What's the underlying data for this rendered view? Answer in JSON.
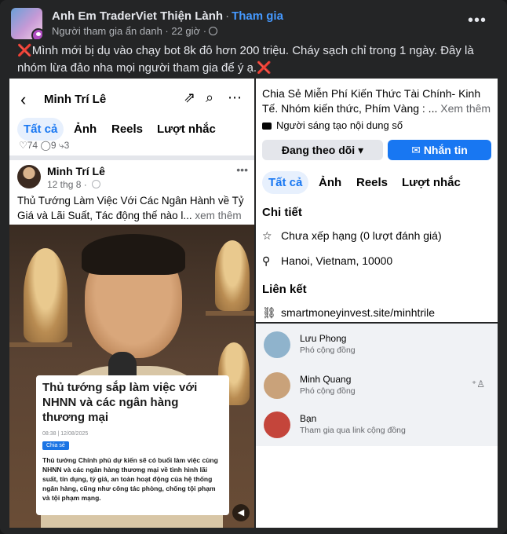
{
  "header": {
    "group_name": "Anh Em TraderViet Thiện Lành",
    "join_label": "Tham gia",
    "meta": "Người tham gia ẩn danh · 22 giờ ·"
  },
  "caption": {
    "mark_start": "❌",
    "text": "Mình mới bị dụ vào chạy bot 8k đô hơn 200 triệu. Cháy sạch chỉ trong 1 ngày. Đây là nhóm lừa đảo nha mọi người tham gia để ý ạ.",
    "mark_end": "❌"
  },
  "left_panel": {
    "profile_name": "Minh Trí Lê",
    "tabs": [
      "Tất cả",
      "Ảnh",
      "Reels",
      "Lượt nhắc"
    ],
    "reaction_row": "♡74    ◯9    ⤷3",
    "post": {
      "author": "Minh Trí Lê",
      "date": "12 thg 8 · ",
      "text": "Thủ Tướng Làm Việc Với Các Ngân Hành về Tỷ Giá và Lãi Suất, Tác động thế nào l...",
      "see_more": " xem thêm"
    },
    "news_card": {
      "headline": "Thủ tướng sắp làm việc với NHNN và các ngân hàng thương mại",
      "timestamp": "08:38 | 12/08/2025",
      "tag": "Chia sẻ",
      "body": "Thủ tướng Chính phủ dự kiến sẽ có buổi làm việc cùng NHNN và các ngân hàng thương mại về tình hình lãi suất, tín dụng, tỷ giá, an toàn hoạt động của hệ thống ngân hàng, cũng như công tác phòng, chống tội phạm và tội phạm mạng."
    }
  },
  "right_panel": {
    "bio": "Chia Sẻ Miễn Phí Kiến Thức Tài Chính- Kinh Tế. Nhóm kiến thức, Phím Vàng : ...",
    "see_more": " Xem thêm",
    "creator": "Người sáng tạo nội dung số",
    "follow_button": "Đang theo dõi ▾",
    "message_button": "Nhắn tin",
    "tabs": [
      "Tất cả",
      "Ảnh",
      "Reels",
      "Lượt nhắc"
    ],
    "details_title": "Chi tiết",
    "rating": "Chưa xếp hạng (0 lượt đánh giá)",
    "location": "Hanoi, Vietnam, 10000",
    "links_title": "Liên kết",
    "link": "smartmoneyinvest.site/minhtrile"
  },
  "members": [
    {
      "name": "Lưu Phong",
      "role": "Phó cộng đồng",
      "color": "#8fb3cc"
    },
    {
      "name": "Minh Quang",
      "role": "Phó cộng đồng",
      "color": "#c9a27a"
    },
    {
      "name": "Bạn",
      "role": "Tham gia qua link cộng đồng",
      "color": "#c4453b"
    }
  ],
  "icons": {
    "more": "more-icon",
    "share": "share-icon",
    "search": "search-icon",
    "star": "star-icon",
    "pin": "location-pin-icon",
    "link": "link-icon",
    "add_friend": "add-friend-icon"
  }
}
